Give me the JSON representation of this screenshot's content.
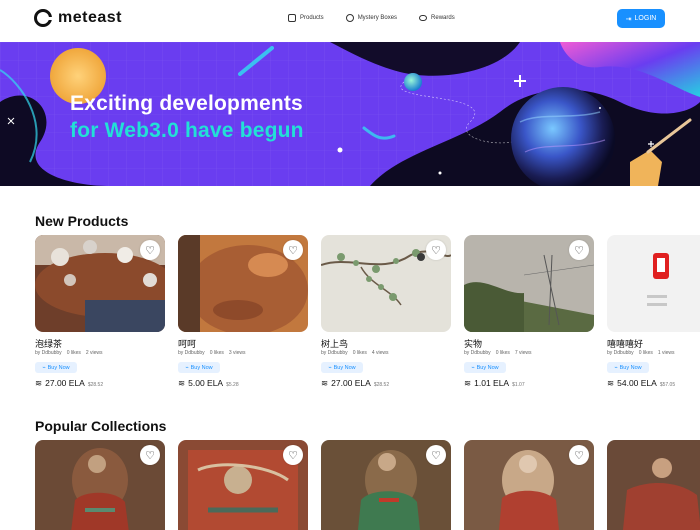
{
  "header": {
    "logo_text": "meteast",
    "nav": [
      {
        "label": "Products",
        "icon": "grid-icon"
      },
      {
        "label": "Mystery Boxes",
        "icon": "box-icon"
      },
      {
        "label": "Rewards",
        "icon": "eye-icon"
      }
    ],
    "login_label": "LOGIN"
  },
  "banner": {
    "line1": "Exciting developments",
    "line2": "for Web3.0 have begun",
    "colors": {
      "bg": "#6a3df0",
      "line1": "#ffffff",
      "line2": "#22e0d6"
    }
  },
  "new_products": {
    "title": "New Products",
    "buy_label": "Buy Now",
    "items": [
      {
        "name": "泡绿茶",
        "author": "by Ddbubby",
        "likes": "0 likes",
        "views": "2 views",
        "price": "27.00 ELA",
        "usd": "$28.52"
      },
      {
        "name": "呵呵",
        "author": "by Ddbubby",
        "likes": "0 likes",
        "views": "3 views",
        "price": "5.00 ELA",
        "usd": "$5.28"
      },
      {
        "name": "树上鸟",
        "author": "by Ddbubby",
        "likes": "0 likes",
        "views": "4 views",
        "price": "27.00 ELA",
        "usd": "$28.52"
      },
      {
        "name": "实物",
        "author": "by Ddbubby",
        "likes": "0 likes",
        "views": "7 views",
        "price": "1.01 ELA",
        "usd": "$1.07"
      },
      {
        "name": "嘻嘻嘻好",
        "author": "by Ddbubby",
        "likes": "0 likes",
        "views": "1 views",
        "price": "54.00 ELA",
        "usd": "$57.05"
      }
    ]
  },
  "popular_collections": {
    "title": "Popular Collections"
  }
}
